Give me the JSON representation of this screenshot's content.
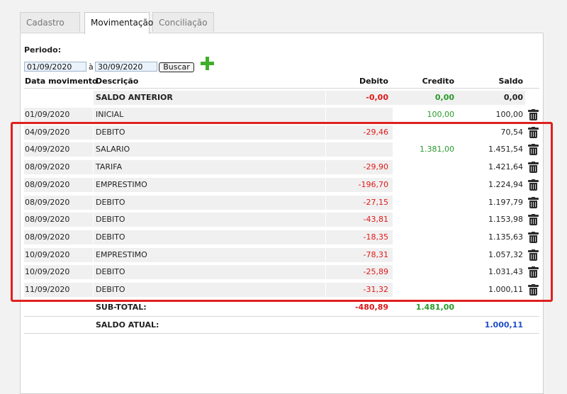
{
  "tabs": [
    {
      "label": "Cadastro"
    },
    {
      "label": "Movimentação"
    },
    {
      "label": "Conciliação"
    }
  ],
  "filter": {
    "periodo_label": "Periodo:",
    "date_from": "01/09/2020",
    "a_label": "à",
    "date_to": "30/09/2020",
    "buscar_label": "Buscar"
  },
  "table": {
    "headers": {
      "data": "Data movimento",
      "descricao": "Descrição",
      "debito": "Debito",
      "credito": "Credito",
      "saldo": "Saldo"
    },
    "saldo_anterior": {
      "descricao": "SALDO ANTERIOR",
      "debito": "-0,00",
      "credito": "0,00",
      "saldo": "0,00"
    },
    "rows": [
      {
        "data": "01/09/2020",
        "descricao": "INICIAL",
        "debito": "",
        "credito": "100,00",
        "saldo": "100,00"
      },
      {
        "data": "04/09/2020",
        "descricao": "DEBITO",
        "debito": "-29,46",
        "credito": "",
        "saldo": "70,54"
      },
      {
        "data": "04/09/2020",
        "descricao": "SALARIO",
        "debito": "",
        "credito": "1.381,00",
        "saldo": "1.451,54"
      },
      {
        "data": "08/09/2020",
        "descricao": "TARIFA",
        "debito": "-29,90",
        "credito": "",
        "saldo": "1.421,64"
      },
      {
        "data": "08/09/2020",
        "descricao": "EMPRESTIMO",
        "debito": "-196,70",
        "credito": "",
        "saldo": "1.224,94"
      },
      {
        "data": "08/09/2020",
        "descricao": "DEBITO",
        "debito": "-27,15",
        "credito": "",
        "saldo": "1.197,79"
      },
      {
        "data": "08/09/2020",
        "descricao": "DEBITO",
        "debito": "-43,81",
        "credito": "",
        "saldo": "1.153,98"
      },
      {
        "data": "08/09/2020",
        "descricao": "DEBITO",
        "debito": "-18,35",
        "credito": "",
        "saldo": "1.135,63"
      },
      {
        "data": "10/09/2020",
        "descricao": "EMPRESTIMO",
        "debito": "-78,31",
        "credito": "",
        "saldo": "1.057,32"
      },
      {
        "data": "10/09/2020",
        "descricao": "DEBITO",
        "debito": "-25,89",
        "credito": "",
        "saldo": "1.031,43"
      },
      {
        "data": "11/09/2020",
        "descricao": "DEBITO",
        "debito": "-31,32",
        "credito": "",
        "saldo": "1.000,11"
      }
    ],
    "subtotal": {
      "descricao": "SUB-TOTAL:",
      "debito": "-480,89",
      "credito": "1.481,00"
    },
    "saldo_atual": {
      "descricao": "SALDO ATUAL:",
      "saldo": "1.000,11"
    }
  },
  "colors": {
    "negative": "#e01818",
    "positive": "#2a9a2a",
    "saldo_atual": "#1f4fc8",
    "highlight_border": "#e02020",
    "add_icon": "#3fae2a"
  },
  "icons": {
    "add": "plus-icon",
    "delete": "trash-icon"
  }
}
